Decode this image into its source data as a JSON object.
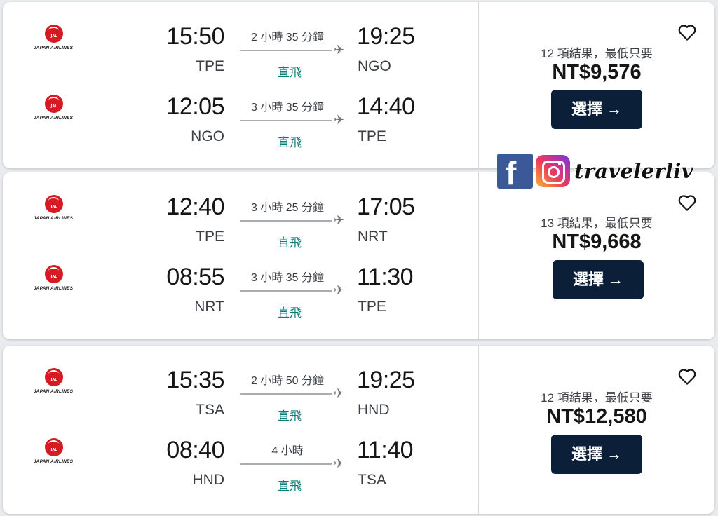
{
  "airline": {
    "brand": "JAPAN AIRLINES",
    "logo_text": "JAL",
    "color": "#d51a22"
  },
  "results": [
    {
      "legs": [
        {
          "dep_time": "15:50",
          "dep_code": "TPE",
          "duration": "2 小時 35 分鐘",
          "stops": "直飛",
          "arr_time": "19:25",
          "arr_code": "NGO"
        },
        {
          "dep_time": "12:05",
          "dep_code": "NGO",
          "duration": "3 小時 35 分鐘",
          "stops": "直飛",
          "arr_time": "14:40",
          "arr_code": "TPE"
        }
      ],
      "results_text": "12 項結果，最低只要",
      "price": "NT$9,576",
      "select_label": "選擇 →"
    },
    {
      "legs": [
        {
          "dep_time": "12:40",
          "dep_code": "TPE",
          "duration": "3 小時 25 分鐘",
          "stops": "直飛",
          "arr_time": "17:05",
          "arr_code": "NRT"
        },
        {
          "dep_time": "08:55",
          "dep_code": "NRT",
          "duration": "3 小時 35 分鐘",
          "stops": "直飛",
          "arr_time": "11:30",
          "arr_code": "TPE"
        }
      ],
      "results_text": "13 項結果，最低只要",
      "price": "NT$9,668",
      "select_label": "選擇 →"
    },
    {
      "legs": [
        {
          "dep_time": "15:35",
          "dep_code": "TSA",
          "duration": "2 小時 50 分鐘",
          "stops": "直飛",
          "arr_time": "19:25",
          "arr_code": "HND"
        },
        {
          "dep_time": "08:40",
          "dep_code": "HND",
          "duration": "4 小時",
          "stops": "直飛",
          "arr_time": "11:40",
          "arr_code": "TSA"
        }
      ],
      "results_text": "12 項結果，最低只要",
      "price": "NT$12,580",
      "select_label": "選擇 →"
    }
  ],
  "watermark": {
    "facebook_glyph": "f",
    "handle": "travelerliv"
  },
  "icons": {
    "favorite": "heart-icon",
    "direction": "airplane-icon"
  },
  "colors": {
    "button_bg": "#0b2038",
    "direct_text": "#0c7d78"
  }
}
